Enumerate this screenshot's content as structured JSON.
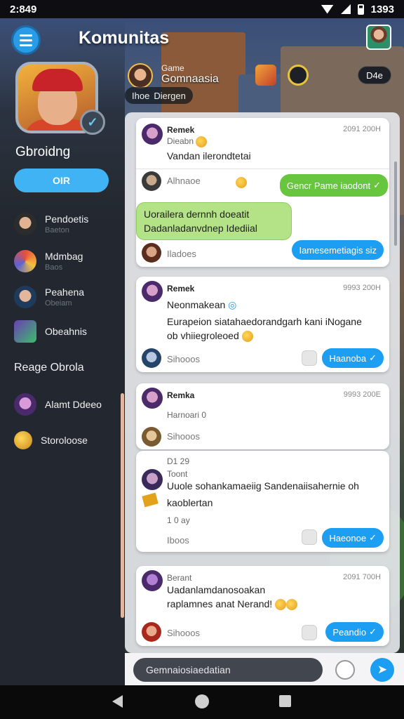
{
  "status_bar": {
    "time": "2:849",
    "clock_right": "1393"
  },
  "header": {
    "title": "Komunitas"
  },
  "profile": {
    "username": "Gbroidng",
    "primary_button": "OIR"
  },
  "sidebar": {
    "items": [
      {
        "label": "Pendoetis",
        "sub": "Baeton"
      },
      {
        "label": "Mdmbag",
        "sub": "Baos"
      },
      {
        "label": "Peahena",
        "sub": "Obeiam"
      },
      {
        "label": "Obeahnis",
        "sub": ""
      }
    ],
    "section_label": "Reage Obrola",
    "section_items": [
      {
        "label": "Alamt Ddeeo"
      },
      {
        "label": "Storoloose"
      }
    ]
  },
  "game": {
    "label": "Game",
    "title": "Gomnaasia",
    "sub": "Ihoe",
    "sub2": "Diergen",
    "pill": "D4e"
  },
  "cards": [
    {
      "name": "Remek",
      "time": "2091 200H",
      "sub": "Dieabn",
      "text": "Vandan ilerondtetai",
      "reply_name": "Alhnaoe",
      "green_bubble_1": "Gencr Pame iaodont",
      "green_bubble_2_l1": "Uorailera dernnh doeatit",
      "green_bubble_2_l2": "Dadanladanvdnep Idediial",
      "foot": "Iladoes",
      "action": "Iamesemetiagis siz"
    },
    {
      "name": "Remek",
      "time": "9993 200H",
      "text": "Neonmakean",
      "line2": "Eurapeion siatahaedorandgarh kani iNogane",
      "line3": "ob vhiiegroleoed",
      "foot": "Sihooos",
      "action": "Haanoba"
    },
    {
      "name": "Remka",
      "time": "9993 200E",
      "text": "Harnoari 0",
      "foot": "Sihooos"
    },
    {
      "time_top": "D1 29",
      "name": "Toont",
      "line1": "Uuole sohankamaeiig Sandenaiisahernie oh",
      "line2": "kaoblertan",
      "line3": "1 0 ay",
      "foot": "Iboos",
      "action": "Haeonoe"
    },
    {
      "name": "Berant",
      "time": "2091 700H",
      "line1": "Uadanlamdanosoakan",
      "line2": "raplamnes anat Nerand!",
      "foot": "Sihooos",
      "action": "Peandio"
    }
  ],
  "composer": {
    "placeholder": "Gemnaiosiaedatian"
  },
  "colors": {
    "accent": "#1c9ef3",
    "green": "#67c53e",
    "sidebar": "#232830"
  }
}
